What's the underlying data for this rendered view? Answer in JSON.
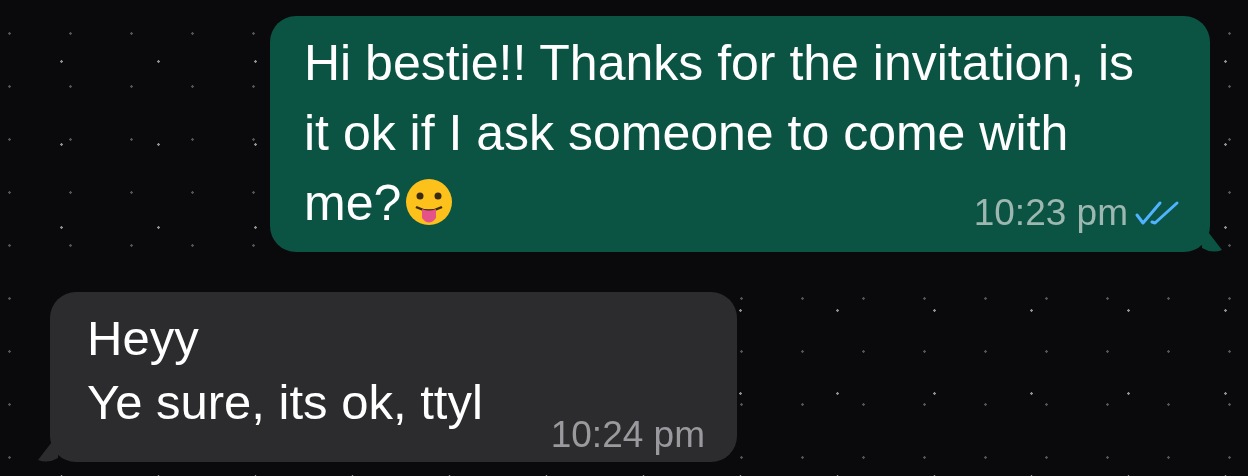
{
  "messages": [
    {
      "kind": "outgoing",
      "lines": [
        "Hi bestie!! Thanks for the invitation, is",
        "it ok if I ask someone to come with",
        "me?"
      ],
      "emoji": true,
      "time": "10:23 pm",
      "read": true
    },
    {
      "kind": "incoming",
      "lines": [
        "Heyy",
        "Ye sure, its ok, ttyl"
      ],
      "time": "10:24 pm"
    }
  ]
}
